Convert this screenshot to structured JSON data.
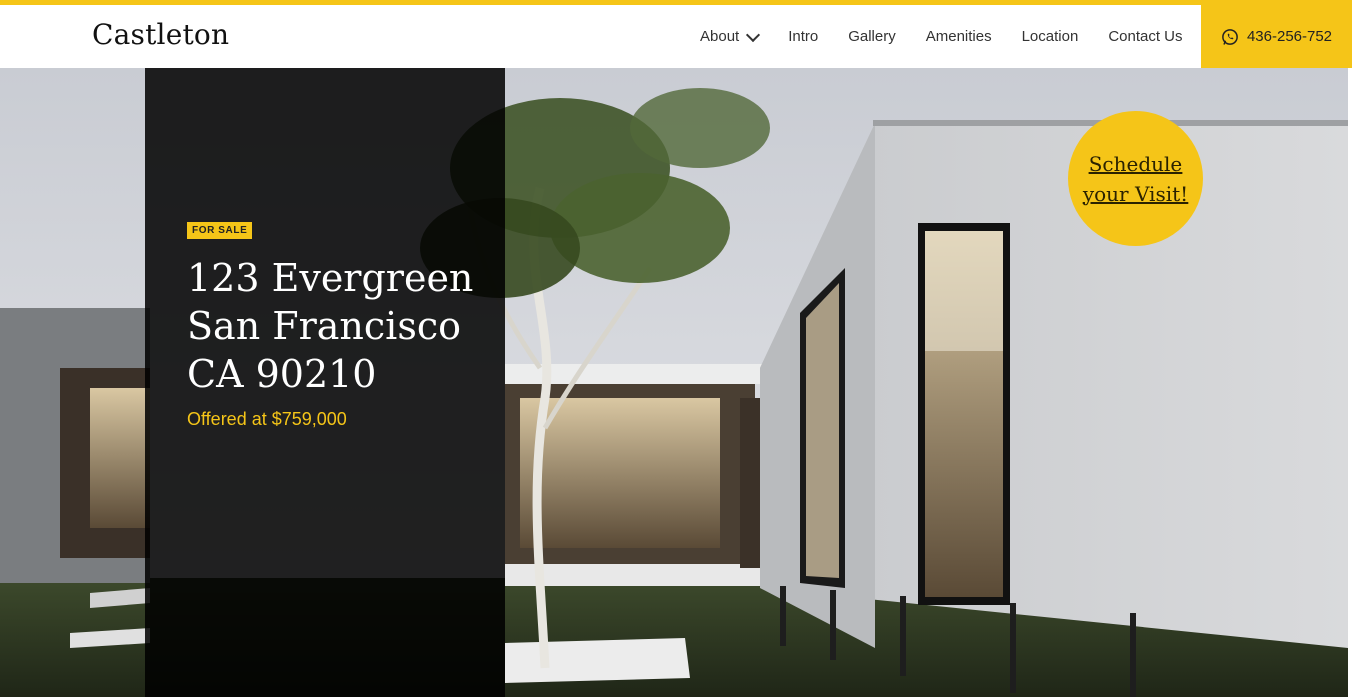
{
  "brand": {
    "logo_text": "Castleton"
  },
  "nav": {
    "items": [
      {
        "label": "About",
        "has_dropdown": true
      },
      {
        "label": "Intro"
      },
      {
        "label": "Gallery"
      },
      {
        "label": "Amenities"
      },
      {
        "label": "Location"
      },
      {
        "label": "Contact Us"
      }
    ],
    "phone": {
      "icon": "whatsapp-icon",
      "label": "436-256-752"
    }
  },
  "listing": {
    "badge": "FOR SALE",
    "address_lines": [
      "123 Evergreen",
      "San Francisco",
      "CA 90210"
    ],
    "price": "Offered at $759,000"
  },
  "cta": {
    "schedule_line1": "Schedule",
    "schedule_line2": "your Visit!"
  },
  "colors": {
    "accent": "#f5c518",
    "panel": "#000000",
    "text_light": "#ffffff"
  }
}
